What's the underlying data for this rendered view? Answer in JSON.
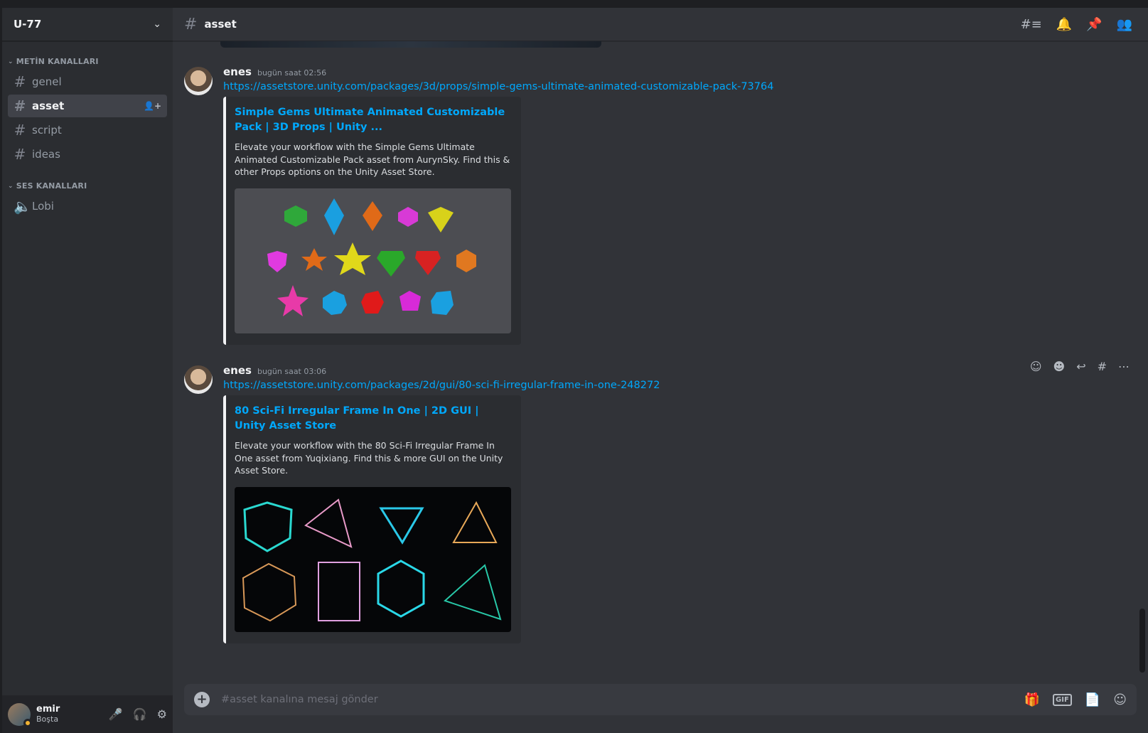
{
  "server": {
    "name": "U-77"
  },
  "categories": {
    "text": {
      "label": "METİN KANALLARI"
    },
    "voice": {
      "label": "SES KANALLARI"
    }
  },
  "channels": [
    {
      "label": "genel"
    },
    {
      "label": "asset"
    },
    {
      "label": "script"
    },
    {
      "label": "ideas"
    }
  ],
  "voice_channels": [
    {
      "label": "Lobi"
    }
  ],
  "user": {
    "name": "emir",
    "status": "Boşta"
  },
  "header": {
    "channel": "asset"
  },
  "messages": [
    {
      "author": "enes",
      "timestamp": "bugün saat 02:56",
      "link": "https://assetstore.unity.com/packages/3d/props/simple-gems-ultimate-animated-customizable-pack-73764",
      "embed_title": "Simple Gems Ultimate Animated Customizable Pack | 3D Props | Unity ...",
      "embed_desc": "Elevate your workflow with the Simple Gems Ultimate Animated Customizable Pack asset from AurynSky. Find this & other Props options on the Unity Asset Store."
    },
    {
      "author": "enes",
      "timestamp": "bugün saat 03:06",
      "link": "https://assetstore.unity.com/packages/2d/gui/80-sci-fi-irregular-frame-in-one-248272",
      "embed_title": "80 Sci-Fi Irregular Frame In One | 2D GUI | Unity Asset Store",
      "embed_desc": "Elevate your workflow with the 80 Sci-Fi Irregular Frame In One asset from Yuqixiang. Find this & more GUI on the Unity Asset Store."
    }
  ],
  "composer": {
    "placeholder": "#asset kanalına mesaj gönder"
  },
  "colors": {
    "link": "#00a8fc",
    "background": "#313338",
    "sidebar": "#2b2d31"
  }
}
